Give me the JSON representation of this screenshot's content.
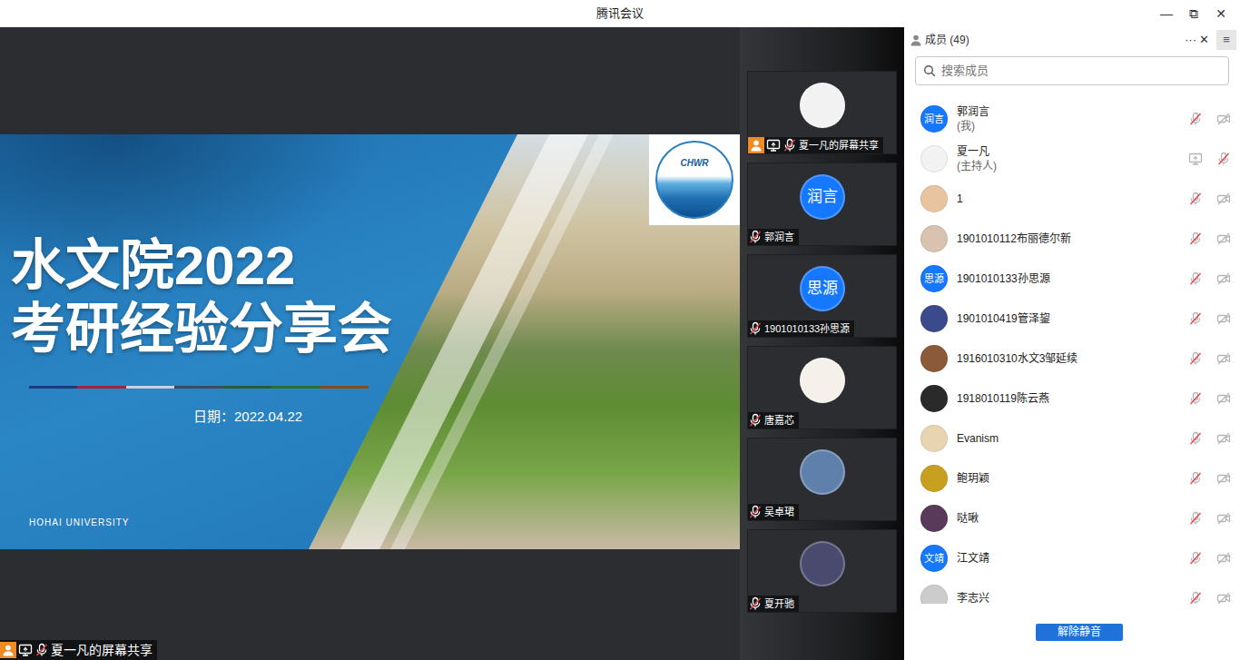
{
  "window": {
    "title": "腾讯会议",
    "controls": [
      "—",
      "⧉",
      "✕"
    ]
  },
  "share": {
    "label": "夏一凡的屏幕共享",
    "slide": {
      "logo": "CHWR",
      "title_lines": [
        "水文院2022",
        "考研经验分享会"
      ],
      "stripe": [
        "#1f3a7a",
        "#a3223c",
        "#c9d2da",
        "#3d4b5b",
        "#2a5a3a",
        "#2f6e33",
        "#8a4a1a"
      ],
      "date": "日期：2022.04.22",
      "footer": "HOHAI UNIVERSITY"
    }
  },
  "tiles": [
    {
      "name": "夏一凡的屏幕共享",
      "avatar": "",
      "color": "#f2f2f2",
      "host": true,
      "sharing": true,
      "mic_muted": true
    },
    {
      "name": "郭润言",
      "avatar": "润言",
      "color": "#1677ff",
      "host": false,
      "sharing": false,
      "mic_muted": true
    },
    {
      "name": "1901010133孙思源",
      "avatar": "思源",
      "color": "#1677ff",
      "host": false,
      "sharing": false,
      "mic_muted": true
    },
    {
      "name": "唐嘉芯",
      "avatar": "",
      "color": "#f5f0ea",
      "host": false,
      "sharing": false,
      "mic_muted": true
    },
    {
      "name": "吴卓珺",
      "avatar": "",
      "color": "#5f80aa",
      "host": false,
      "sharing": false,
      "mic_muted": true
    },
    {
      "name": "夏开驰",
      "avatar": "",
      "color": "#4a4a6e",
      "host": false,
      "sharing": false,
      "mic_muted": true
    }
  ],
  "members_panel": {
    "title": "成员 (49)",
    "more": "···",
    "close": "✕",
    "side": "≡",
    "search": {
      "placeholder": "搜索成员"
    },
    "members": [
      {
        "name": "郭润言",
        "sub": "(我)",
        "avatar": "润言",
        "color": "#1677ff",
        "sharing": false,
        "mic_muted": true,
        "camera_off": true
      },
      {
        "name": "夏一凡",
        "sub": "(主持人)",
        "avatar": "",
        "color": "#f2f2f2",
        "sharing": true,
        "mic_muted": true,
        "camera_off": false
      },
      {
        "name": "1",
        "sub": "",
        "avatar": "",
        "color": "#e8c4a0",
        "sharing": false,
        "mic_muted": true,
        "camera_off": true
      },
      {
        "name": "1901010112布丽德尔新",
        "sub": "",
        "avatar": "",
        "color": "#d9c2b0",
        "sharing": false,
        "mic_muted": true,
        "camera_off": true
      },
      {
        "name": "1901010133孙思源",
        "sub": "",
        "avatar": "思源",
        "color": "#1677ff",
        "sharing": false,
        "mic_muted": true,
        "camera_off": true
      },
      {
        "name": "1901010419管泽鋆",
        "sub": "",
        "avatar": "",
        "color": "#3a4a8a",
        "sharing": false,
        "mic_muted": true,
        "camera_off": true
      },
      {
        "name": "1916010310水文3邹延续",
        "sub": "",
        "avatar": "",
        "color": "#8a5a3a",
        "sharing": false,
        "mic_muted": true,
        "camera_off": true
      },
      {
        "name": "1918010119陈云燕",
        "sub": "",
        "avatar": "",
        "color": "#2a2a2a",
        "sharing": false,
        "mic_muted": true,
        "camera_off": true
      },
      {
        "name": "Evanism",
        "sub": "",
        "avatar": "",
        "color": "#e8d4b0",
        "sharing": false,
        "mic_muted": true,
        "camera_off": true
      },
      {
        "name": "鲍玥颖",
        "sub": "",
        "avatar": "",
        "color": "#c8a020",
        "sharing": false,
        "mic_muted": true,
        "camera_off": true
      },
      {
        "name": "哒啾",
        "sub": "",
        "avatar": "",
        "color": "#5a3a5a",
        "sharing": false,
        "mic_muted": true,
        "camera_off": true
      },
      {
        "name": "江文靖",
        "sub": "",
        "avatar": "文靖",
        "color": "#1677ff",
        "sharing": false,
        "mic_muted": true,
        "camera_off": true
      },
      {
        "name": "李志兴",
        "sub": "",
        "avatar": "",
        "color": "#cccccc",
        "sharing": false,
        "mic_muted": true,
        "camera_off": true
      }
    ],
    "button": "解除静音"
  }
}
